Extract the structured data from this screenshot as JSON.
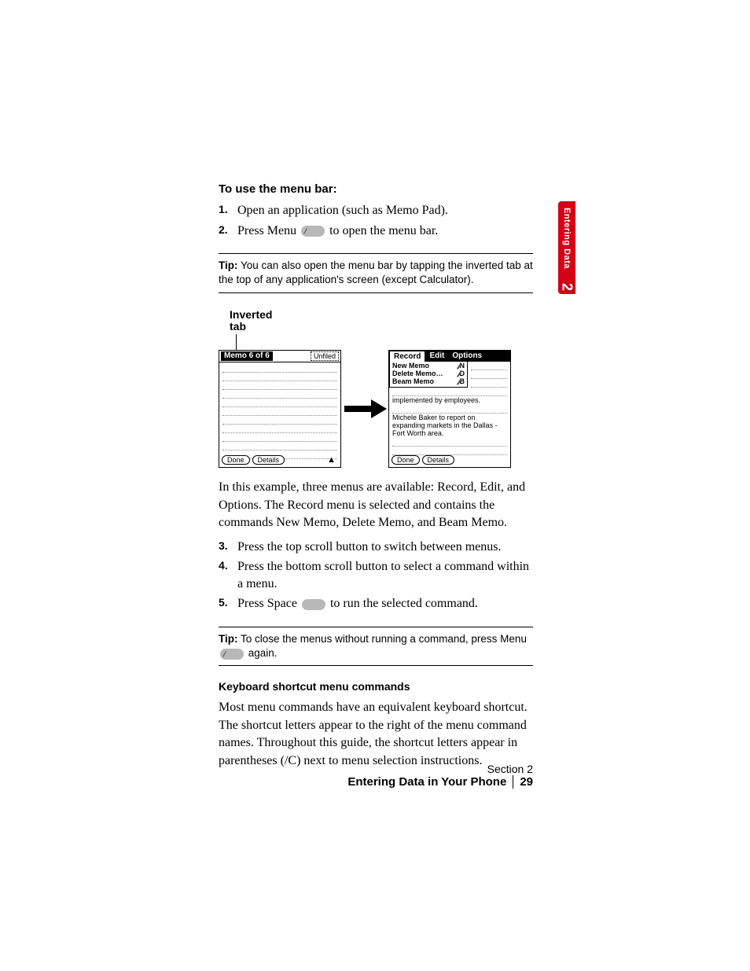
{
  "sidetab": {
    "label": "Entering Data",
    "num": "2"
  },
  "h1": "To use the menu bar:",
  "steps1": [
    {
      "n": "1.",
      "t": "Open an application (such as Memo Pad)."
    },
    {
      "n": "2.",
      "t_before": "Press Menu ",
      "t_after": " to open the menu bar."
    }
  ],
  "tip1": {
    "label": "Tip:",
    "text": " You can also open the menu bar by tapping the inverted tab at the top of any application's screen (except Calculator)."
  },
  "figure": {
    "label1": "Inverted",
    "label2": "tab",
    "left": {
      "title": "Memo 6 of 6",
      "category": "Unfiled",
      "btnDone": "Done",
      "btnDetails": "Details"
    },
    "right": {
      "menus": [
        "Record",
        "Edit",
        "Options"
      ],
      "dropdown": [
        {
          "label": "New Memo",
          "key": "N"
        },
        {
          "label": "Delete Memo…",
          "key": "D"
        },
        {
          "label": "Beam Memo",
          "key": "B"
        }
      ],
      "body1": "implemented by employees.",
      "body2": "Michele Baker to report on expanding markets in the Dallas - Fort Worth area.",
      "btnDone": "Done",
      "btnDetails": "Details"
    }
  },
  "para1": "In this example, three menus are available: Record, Edit, and Options. The Record menu is selected and contains the commands New Memo, Delete Memo, and Beam Memo.",
  "steps2": [
    {
      "n": "3.",
      "t": "Press the top scroll button to switch between menus."
    },
    {
      "n": "4.",
      "t": "Press the bottom scroll button to select a command within a menu."
    },
    {
      "n": "5.",
      "t_before": "Press Space ",
      "t_after": " to run the selected command."
    }
  ],
  "tip2": {
    "label": "Tip:",
    "text_before": " To close the menus without running a command, press Menu ",
    "text_after": " again."
  },
  "h2": "Keyboard shortcut menu commands",
  "para2": "Most menu commands have an equivalent keyboard shortcut. The shortcut letters appear to the right of the menu command names. Throughout this guide, the shortcut letters appear in parentheses (/C) next to menu selection instructions.",
  "footer": {
    "section": "Section 2",
    "title": "Entering Data in Your Phone",
    "page": "29"
  }
}
